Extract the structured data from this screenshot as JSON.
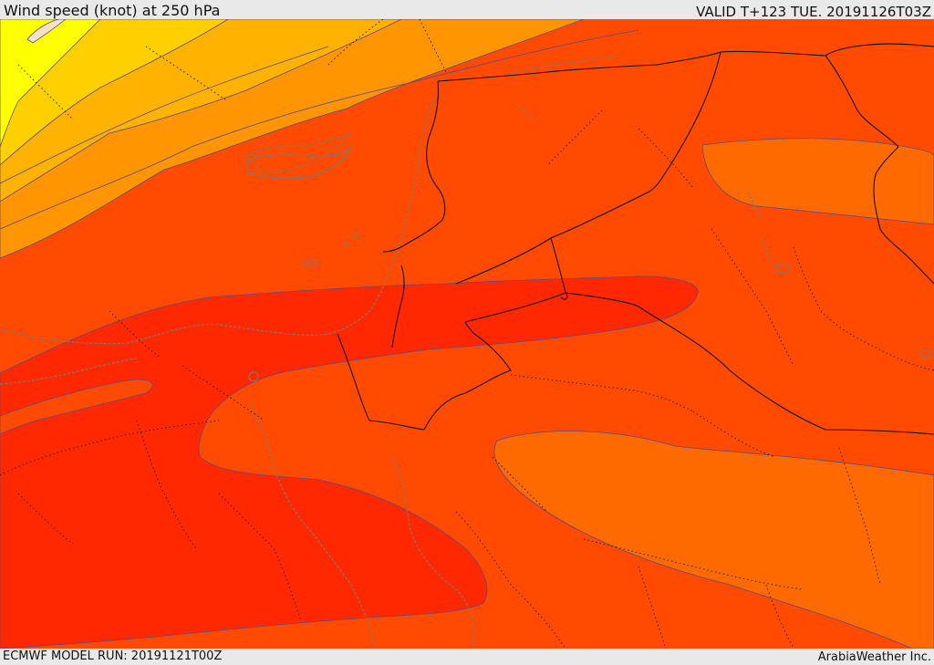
{
  "header": {
    "title": "Wind speed (knot) at 250 hPa",
    "valid_time": "VALID T+123 TUE. 20191126T03Z"
  },
  "footer": {
    "model_run": "ECMWF MODEL RUN: 20191121T00Z",
    "credit": "ArabiaWeather Inc."
  },
  "map": {
    "variable": "wind speed",
    "level": "250 hPa",
    "unit": "knot",
    "colors": {
      "band_lightest": "#f5e0c8",
      "band_yellow": "#ffff00",
      "band_yellow_orange": "#ffd000",
      "band_gold": "#ffb300",
      "band_orange": "#ff9500",
      "band_dark_orange": "#ff6a00",
      "band_red_orange": "#ff4a00",
      "band_red": "#ff2800",
      "contour_line": "#5a4a8a",
      "coastline": "#7a7a7a",
      "border": "#111111"
    }
  }
}
